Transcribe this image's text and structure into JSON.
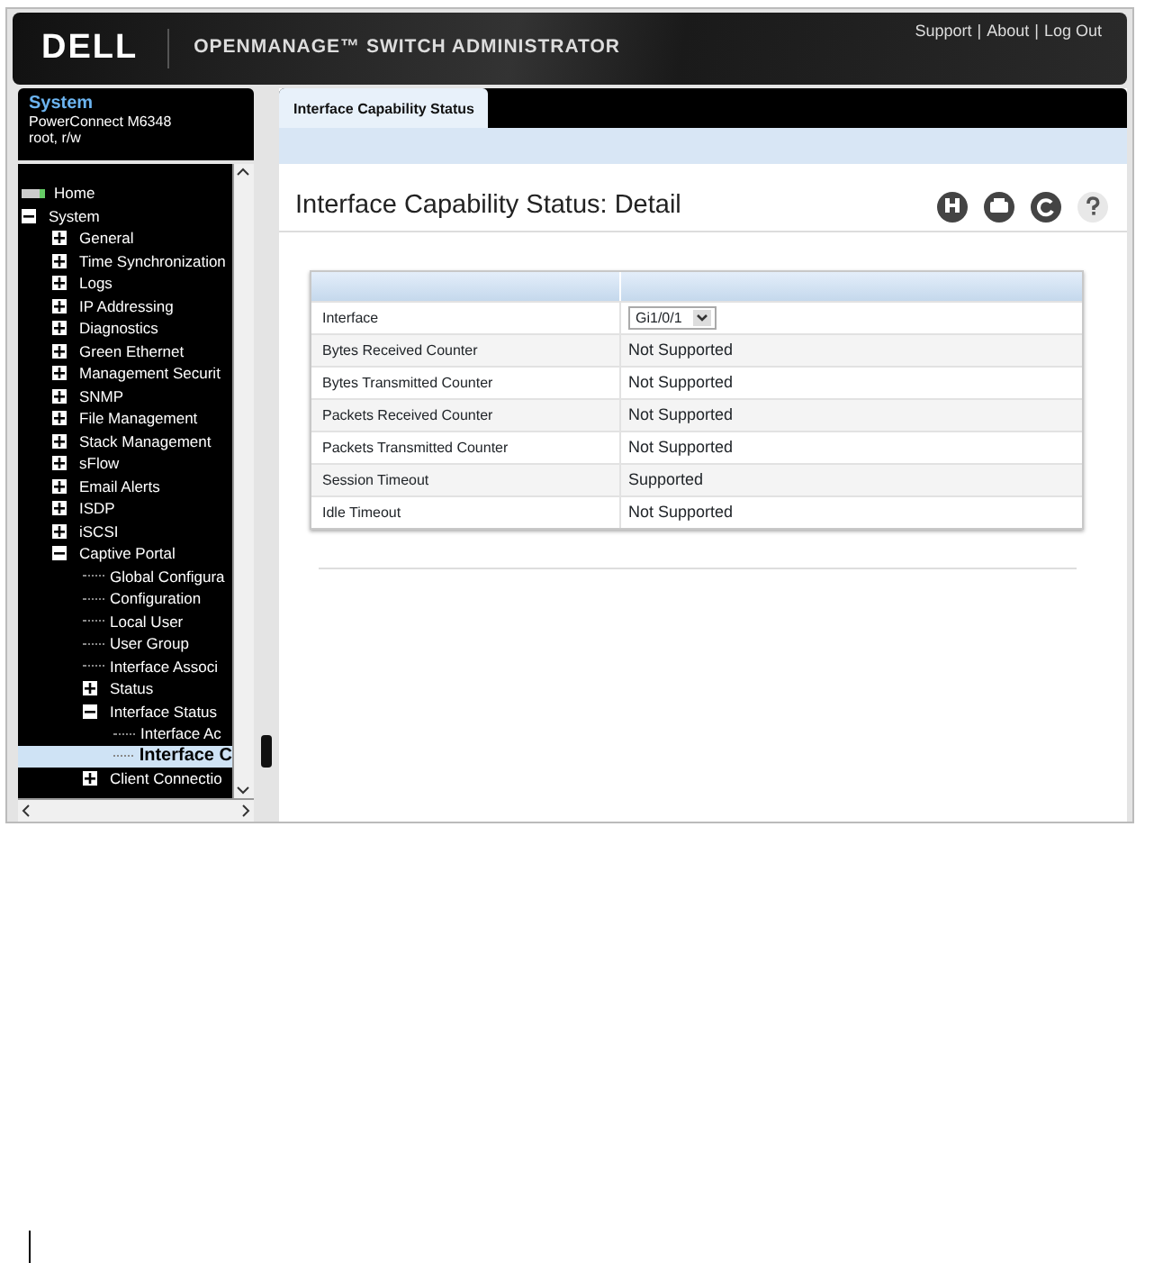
{
  "header": {
    "brand": "DELL",
    "product": "OPENMANAGE™ SWITCH ADMINISTRATOR",
    "links": [
      "Support",
      "About",
      "Log Out"
    ],
    "separator": "|"
  },
  "device": {
    "title": "System",
    "model": "PowerConnect M6348",
    "user": "root, r/w"
  },
  "tree": [
    {
      "label": "Home",
      "kind": "home",
      "selected": false
    },
    {
      "label": "System",
      "kind": "folder",
      "expanded": true,
      "selected": false,
      "children": [
        {
          "label": "General",
          "kind": "folder",
          "expanded": false,
          "selected": false
        },
        {
          "label": "Time Synchronization",
          "kind": "folder",
          "expanded": false,
          "selected": false
        },
        {
          "label": "Logs",
          "kind": "folder",
          "expanded": false,
          "selected": false
        },
        {
          "label": "IP Addressing",
          "kind": "folder",
          "expanded": false,
          "selected": false
        },
        {
          "label": "Diagnostics",
          "kind": "folder",
          "expanded": false,
          "selected": false
        },
        {
          "label": "Green Ethernet",
          "kind": "folder",
          "expanded": false,
          "selected": false
        },
        {
          "label": "Management Securit",
          "kind": "folder",
          "expanded": false,
          "selected": false
        },
        {
          "label": "SNMP",
          "kind": "folder",
          "expanded": false,
          "selected": false
        },
        {
          "label": "File Management",
          "kind": "folder",
          "expanded": false,
          "selected": false
        },
        {
          "label": "Stack Management",
          "kind": "folder",
          "expanded": false,
          "selected": false
        },
        {
          "label": "sFlow",
          "kind": "folder",
          "expanded": false,
          "selected": false
        },
        {
          "label": "Email Alerts",
          "kind": "folder",
          "expanded": false,
          "selected": false
        },
        {
          "label": "ISDP",
          "kind": "folder",
          "expanded": false,
          "selected": false
        },
        {
          "label": "iSCSI",
          "kind": "folder",
          "expanded": false,
          "selected": false
        },
        {
          "label": "Captive Portal",
          "kind": "folder",
          "expanded": true,
          "selected": false,
          "children": [
            {
              "label": "Global Configura",
              "kind": "leaf",
              "selected": false
            },
            {
              "label": "Configuration",
              "kind": "leaf",
              "selected": false
            },
            {
              "label": "Local User",
              "kind": "leaf",
              "selected": false
            },
            {
              "label": "User Group",
              "kind": "leaf",
              "selected": false
            },
            {
              "label": "Interface Associ",
              "kind": "leaf",
              "selected": false
            },
            {
              "label": "Status",
              "kind": "folder",
              "expanded": false,
              "selected": false
            },
            {
              "label": "Interface Status",
              "kind": "folder",
              "expanded": true,
              "selected": false,
              "children": [
                {
                  "label": "Interface Ac",
                  "kind": "leaf",
                  "selected": false
                },
                {
                  "label": "Interface C",
                  "kind": "leaf",
                  "selected": true
                }
              ]
            },
            {
              "label": "Client Connectio",
              "kind": "folder",
              "expanded": false,
              "selected": false
            }
          ]
        }
      ]
    }
  ],
  "tabs": [
    {
      "label": "Interface Capability Status",
      "selected": true
    }
  ],
  "page_title": "Interface Capability Status: Detail",
  "table": {
    "rows": [
      {
        "label": "Interface",
        "kind": "select",
        "value": "Gi1/0/1"
      },
      {
        "label": "Bytes Received Counter",
        "kind": "text",
        "value": "Not Supported"
      },
      {
        "label": "Bytes Transmitted Counter",
        "kind": "text",
        "value": "Not Supported"
      },
      {
        "label": "Packets Received Counter",
        "kind": "text",
        "value": "Not Supported"
      },
      {
        "label": "Packets Transmitted Counter",
        "kind": "text",
        "value": "Not Supported"
      },
      {
        "label": "Session Timeout",
        "kind": "text",
        "value": "Supported"
      },
      {
        "label": "Idle Timeout",
        "kind": "text",
        "value": "Not Supported"
      }
    ]
  }
}
